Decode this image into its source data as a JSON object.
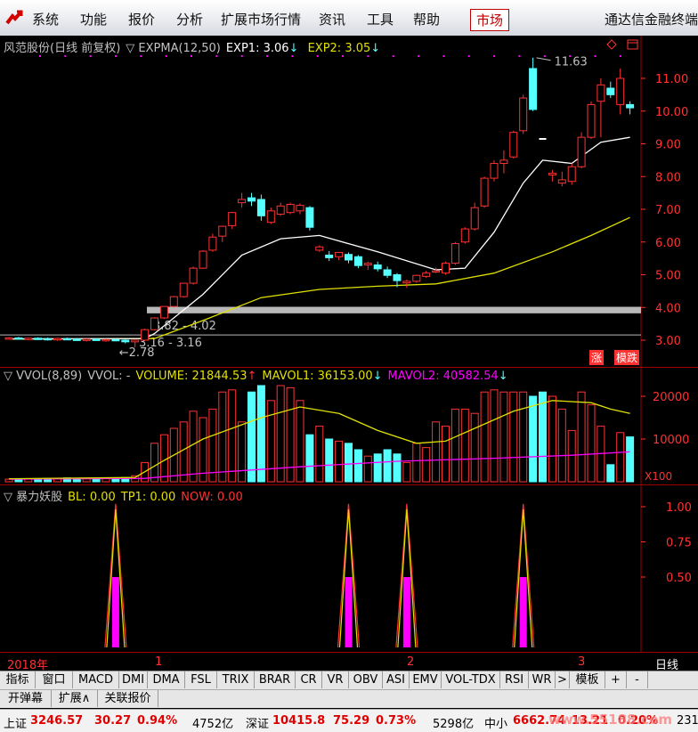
{
  "menu": {
    "items": [
      "系统",
      "功能",
      "报价",
      "分析",
      "扩展市场行情",
      "资讯",
      "工具",
      "帮助"
    ],
    "active": "市场",
    "brand": "通达信金融终端"
  },
  "main_panel": {
    "title": "风范股份(日线 前复权)",
    "indicator": "▽ EXPMA(12,50)",
    "exp1": "EXP1: 3.06",
    "exp1_arrow": "↓",
    "exp2": "EXP2: 3.05",
    "exp2_arrow": "↓",
    "price_axis": [
      "11.00",
      "10.00",
      "9.00",
      "8.00",
      "7.00",
      "6.00",
      "5.00",
      "4.00",
      "3.00"
    ],
    "high_label": "11.63",
    "low_label": "2.78",
    "band1_label": "3.82 - 4.02",
    "band2_label": "3.16 - 3.16",
    "badge_up": "涨",
    "badge_down": "模跌"
  },
  "vol_panel": {
    "name": "▽ VVOL(8,89)",
    "vvol": "VVOL: -",
    "volume": "VOLUME: 21844.53",
    "volume_arrow": "↑",
    "mavol1": "MAVOL1: 36153.00",
    "mavol1_arrow": "↓",
    "mavol2": "MAVOL2: 40582.54",
    "mavol2_arrow": "↓",
    "axis": [
      "20000",
      "10000"
    ],
    "unit": "X100"
  },
  "ind_panel": {
    "name": "▽ 暴力妖股",
    "bl": "BL: 0.00",
    "tp1": "TP1: 0.00",
    "now": "NOW: 0.00",
    "axis": [
      "1.00",
      "0.75",
      "0.50"
    ]
  },
  "date_axis": {
    "year": "2018年",
    "months": [
      "1",
      "2",
      "3"
    ],
    "period": "日线"
  },
  "tabs": [
    "指标",
    "窗口",
    "MACD",
    "DMI",
    "DMA",
    "FSL",
    "TRIX",
    "BRAR",
    "CR",
    "VR",
    "OBV",
    "ASI",
    "EMV",
    "VOL-TDX",
    "RSI",
    "WR",
    ">",
    "模板",
    "+",
    "-"
  ],
  "row2": [
    "开弹幕",
    "扩展∧",
    "关联报价"
  ],
  "status": {
    "sh_name": "上证",
    "sh_val": "3246.57",
    "sh_chg": "30.27",
    "sh_pct": "0.94%",
    "sh_amt": "4752亿",
    "sz_name": "深证",
    "sz_val": "10415.8",
    "sz_chg": "75.29",
    "sz_pct": "0.73%",
    "sz_amt": "5298亿",
    "zx_name": "中小",
    "zx_val": "6662.74",
    "zx_chg": "13.21",
    "zx_pct": "0.20%",
    "zx_amt": "231",
    "watermark": "www.55188.com"
  },
  "colors": {
    "up": "#ff3232",
    "down": "#54ffff",
    "exp1": "#ffffff",
    "exp2": "#e0e000",
    "mavol2": "#ff00ff"
  },
  "chart_data": {
    "type": "candlestick",
    "candles": [
      [
        3.06,
        3.1,
        3.02,
        3.07
      ],
      [
        3.07,
        3.1,
        3.02,
        3.04
      ],
      [
        3.04,
        3.08,
        3.0,
        3.06
      ],
      [
        3.06,
        3.09,
        3.01,
        3.05
      ],
      [
        3.05,
        3.08,
        2.99,
        3.02
      ],
      [
        3.02,
        3.07,
        2.98,
        3.05
      ],
      [
        3.05,
        3.08,
        3.0,
        3.03
      ],
      [
        3.03,
        3.06,
        2.98,
        3.01
      ],
      [
        3.01,
        3.05,
        2.96,
        3.03
      ],
      [
        3.03,
        3.06,
        2.99,
        3.0
      ],
      [
        3.0,
        3.04,
        2.95,
        3.02
      ],
      [
        3.02,
        3.05,
        2.97,
        3.0
      ],
      [
        3.0,
        3.03,
        2.9,
        2.95
      ],
      [
        2.95,
        3.02,
        2.78,
        3.0
      ],
      [
        3.0,
        3.35,
        2.98,
        3.32
      ],
      [
        3.32,
        3.7,
        3.3,
        3.68
      ],
      [
        3.68,
        4.03,
        3.65,
        4.03
      ],
      [
        4.03,
        4.35,
        4.0,
        4.33
      ],
      [
        4.33,
        4.75,
        4.3,
        4.74
      ],
      [
        4.74,
        5.25,
        4.7,
        5.2
      ],
      [
        5.2,
        5.75,
        5.18,
        5.72
      ],
      [
        5.75,
        6.25,
        5.7,
        6.15
      ],
      [
        6.18,
        6.5,
        6.0,
        6.48
      ],
      [
        6.5,
        6.92,
        6.4,
        6.9
      ],
      [
        7.2,
        7.5,
        7.05,
        7.3
      ],
      [
        7.35,
        7.5,
        7.1,
        7.25
      ],
      [
        7.3,
        7.45,
        6.65,
        6.8
      ],
      [
        6.6,
        7.05,
        6.55,
        6.95
      ],
      [
        6.85,
        7.2,
        6.8,
        7.1
      ],
      [
        6.9,
        7.2,
        6.85,
        7.15
      ],
      [
        6.95,
        7.18,
        6.85,
        7.12
      ],
      [
        7.05,
        7.1,
        6.35,
        6.45
      ],
      [
        5.75,
        5.9,
        5.7,
        5.85
      ],
      [
        5.6,
        5.72,
        5.42,
        5.52
      ],
      [
        5.55,
        5.7,
        5.45,
        5.68
      ],
      [
        5.62,
        5.68,
        5.35,
        5.45
      ],
      [
        5.55,
        5.6,
        5.2,
        5.28
      ],
      [
        5.3,
        5.4,
        5.15,
        5.35
      ],
      [
        5.3,
        5.4,
        5.1,
        5.18
      ],
      [
        5.15,
        5.25,
        4.9,
        4.98
      ],
      [
        5.0,
        5.05,
        4.62,
        4.82
      ],
      [
        4.75,
        4.85,
        4.6,
        4.8
      ],
      [
        4.8,
        5.0,
        4.75,
        4.98
      ],
      [
        4.95,
        5.12,
        4.9,
        5.05
      ],
      [
        5.1,
        5.22,
        5.05,
        5.12
      ],
      [
        5.05,
        5.4,
        5.0,
        5.35
      ],
      [
        5.35,
        6.0,
        5.3,
        5.95
      ],
      [
        6.0,
        6.45,
        5.95,
        6.4
      ],
      [
        6.4,
        7.2,
        6.35,
        7.05
      ],
      [
        7.1,
        8.0,
        7.05,
        7.95
      ],
      [
        7.95,
        8.5,
        7.85,
        8.4
      ],
      [
        8.4,
        8.8,
        8.1,
        8.5
      ],
      [
        8.6,
        9.4,
        8.55,
        9.35
      ],
      [
        9.4,
        10.5,
        9.3,
        10.4
      ],
      [
        11.3,
        11.63,
        10.0,
        10.05
      ],
      [
        null,
        null,
        null,
        null
      ],
      [
        8.05,
        8.2,
        7.85,
        8.1
      ],
      [
        7.8,
        8.15,
        7.7,
        7.9
      ],
      [
        7.85,
        8.4,
        7.75,
        8.3
      ],
      [
        8.3,
        9.35,
        8.25,
        9.2
      ],
      [
        9.2,
        10.3,
        9.15,
        10.2
      ],
      [
        10.3,
        11.0,
        9.2,
        10.8
      ],
      [
        10.7,
        10.9,
        10.4,
        10.5
      ],
      [
        10.2,
        11.3,
        9.9,
        11.0
      ],
      [
        10.2,
        10.3,
        9.9,
        10.1
      ]
    ],
    "exp1": [
      [
        0,
        3.04
      ],
      [
        14,
        3.05
      ],
      [
        15,
        3.2
      ],
      [
        20,
        4.4
      ],
      [
        24,
        5.6
      ],
      [
        28,
        6.1
      ],
      [
        32,
        6.2
      ],
      [
        38,
        5.7
      ],
      [
        44,
        5.15
      ],
      [
        47,
        5.2
      ],
      [
        50,
        6.3
      ],
      [
        53,
        7.8
      ],
      [
        55,
        8.5
      ],
      [
        58,
        8.4
      ],
      [
        61,
        9.05
      ],
      [
        64,
        9.2
      ]
    ],
    "exp2": [
      [
        0,
        3.03
      ],
      [
        15,
        3.05
      ],
      [
        20,
        3.6
      ],
      [
        26,
        4.3
      ],
      [
        32,
        4.55
      ],
      [
        38,
        4.65
      ],
      [
        44,
        4.72
      ],
      [
        50,
        5.05
      ],
      [
        56,
        5.7
      ],
      [
        60,
        6.2
      ],
      [
        64,
        6.75
      ]
    ],
    "volume": [
      [
        0,
        600
      ],
      [
        1,
        500
      ],
      [
        2,
        700
      ],
      [
        3,
        600
      ],
      [
        4,
        800
      ],
      [
        5,
        700
      ],
      [
        6,
        900
      ],
      [
        7,
        600
      ],
      [
        8,
        700
      ],
      [
        9,
        800
      ],
      [
        10,
        900
      ],
      [
        11,
        700
      ],
      [
        12,
        1000
      ],
      [
        13,
        1400
      ],
      [
        14,
        4500
      ],
      [
        15,
        9000
      ],
      [
        16,
        11000
      ],
      [
        17,
        12500
      ],
      [
        18,
        14000
      ],
      [
        19,
        16500
      ],
      [
        20,
        15000
      ],
      [
        21,
        17000
      ],
      [
        22,
        21000
      ],
      [
        23,
        21500
      ],
      [
        24,
        14000
      ],
      [
        25,
        21000
      ],
      [
        26,
        22500
      ],
      [
        27,
        19000
      ],
      [
        28,
        22500
      ],
      [
        29,
        22000
      ],
      [
        30,
        19000
      ],
      [
        31,
        11000
      ],
      [
        32,
        13000
      ],
      [
        33,
        10000
      ],
      [
        34,
        9500
      ],
      [
        35,
        9000
      ],
      [
        36,
        7500
      ],
      [
        37,
        6000
      ],
      [
        38,
        6500
      ],
      [
        39,
        7500
      ],
      [
        40,
        6500
      ],
      [
        41,
        4500
      ],
      [
        42,
        9000
      ],
      [
        43,
        8000
      ],
      [
        44,
        14000
      ],
      [
        45,
        13000
      ],
      [
        46,
        17000
      ],
      [
        47,
        17000
      ],
      [
        48,
        16000
      ],
      [
        49,
        21000
      ],
      [
        50,
        21500
      ],
      [
        51,
        21000
      ],
      [
        52,
        21000
      ],
      [
        53,
        21000
      ],
      [
        54,
        20000
      ],
      [
        55,
        21000
      ],
      [
        56,
        20000
      ],
      [
        57,
        17000
      ],
      [
        58,
        12000
      ],
      [
        59,
        21000
      ],
      [
        60,
        18000
      ],
      [
        61,
        13000
      ],
      [
        62,
        4000
      ],
      [
        63,
        11500
      ],
      [
        64,
        10500
      ]
    ],
    "signals": [
      11,
      35,
      41,
      53
    ]
  }
}
